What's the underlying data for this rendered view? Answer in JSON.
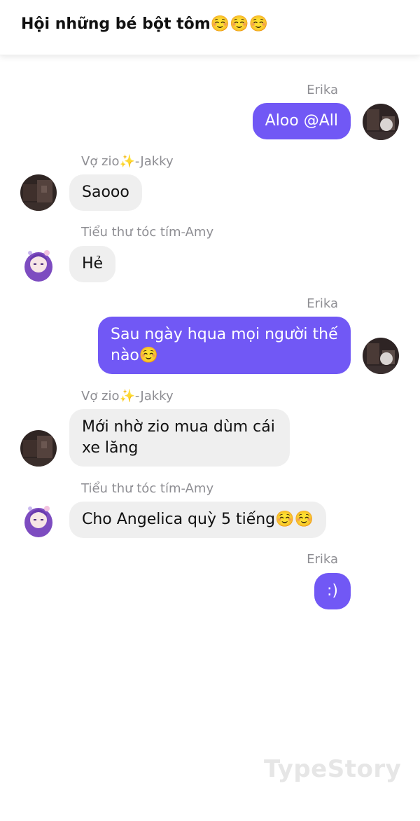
{
  "header": {
    "title": "Hội những bé bột tôm☺️☺️☺️"
  },
  "colors": {
    "outgoing_bubble": "#7158f5",
    "incoming_bubble": "#efefef",
    "sender_name": "#8e8e93"
  },
  "messages": [
    {
      "sender": "Erika",
      "text": "Aloo @All",
      "side": "right",
      "avatar_icon": "dark-photo-avatar-icon"
    },
    {
      "sender": "Vợ zio✨-Jakky",
      "text": "Saooo",
      "side": "left",
      "avatar_icon": "dark-photo-avatar-icon"
    },
    {
      "sender": "Tiểu thư tóc tím-Amy",
      "text": "Hẻ",
      "side": "left",
      "avatar_icon": "purple-hair-anime-avatar-icon"
    },
    {
      "sender": "Erika",
      "text": "Sau ngày hqua mọi người thế nào☺️",
      "side": "right",
      "avatar_icon": "dark-photo-avatar-icon"
    },
    {
      "sender": "Vợ zio✨-Jakky",
      "text": "Mới nhờ zio mua dùm cái xe lăng",
      "side": "left",
      "avatar_icon": "dark-photo-avatar-icon"
    },
    {
      "sender": "Tiểu thư tóc tím-Amy",
      "text": "Cho Angelica quỳ 5 tiếng☺️☺️",
      "side": "left",
      "avatar_icon": "purple-hair-anime-avatar-icon"
    },
    {
      "sender": "Erika",
      "text": ":)",
      "side": "right",
      "avatar_icon": "none"
    }
  ],
  "watermark": "TypeStory"
}
